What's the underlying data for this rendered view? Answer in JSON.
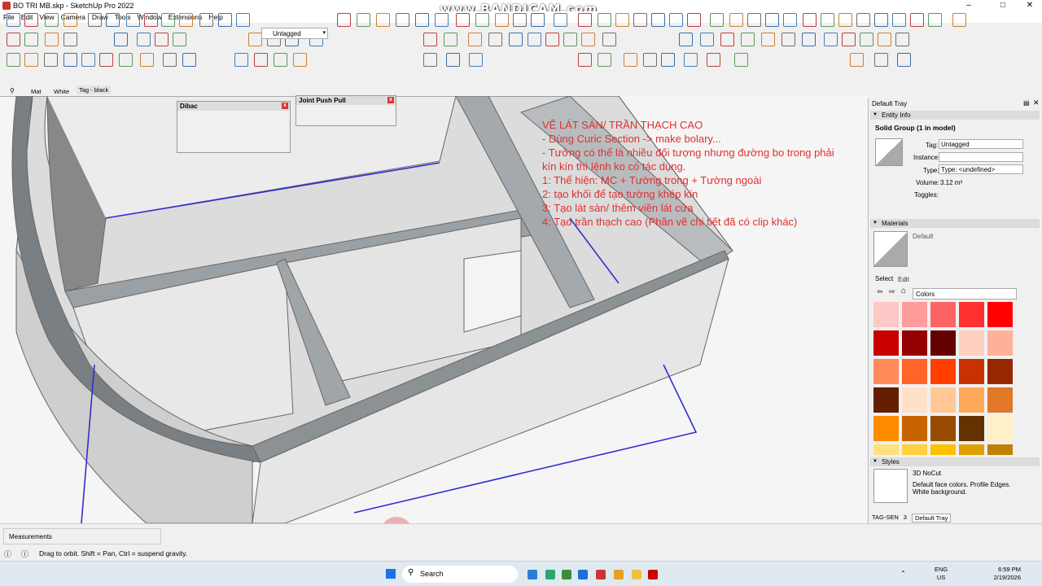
{
  "window": {
    "title": "BO TRI MB.skp - SketchUp Pro 2022",
    "watermark": "www.BANDICAM.com",
    "minimize": "–",
    "maximize": "□",
    "close": "✕"
  },
  "menu": [
    "File",
    "Edit",
    "View",
    "Camera",
    "Draw",
    "Tools",
    "Window",
    "Extensions",
    "Help"
  ],
  "toolbar": {
    "tag_select": "Untagged",
    "scene_tabs": [
      "Mat",
      "White",
      "Tag - black"
    ]
  },
  "dibac": {
    "title": "Dibac"
  },
  "joint": {
    "title": "Joint Push Pull"
  },
  "note": {
    "lines": [
      "VẼ LÁT SÀN/ TRẦN THẠCH CAO",
      "- Dùng Curic Section -> make bolary...",
      "- Tường có thể là nhiều đối tượng nhưng đường bo trong phải",
      "kín kín thì lệnh ko có tác dụng.",
      "1: Thể hiện: MC + Tường trong + Tường ngoài",
      "2: tạo khối để tạo tường khép kín",
      "3: Tạo lát sàn/ thêm viền lát cửa",
      "4: Tạo trần thạch cao (Phần vẽ chi tiết đã có clip khác)"
    ]
  },
  "tray": {
    "title": "Default Tray",
    "entity_info": {
      "header": "Entity Info",
      "selection": "Solid Group (1 in model)",
      "tag_label": "Tag:",
      "tag_value": "Untagged",
      "instance_label": "Instance:",
      "type_label": "Type:",
      "type_value": "Type: <undefined>",
      "volume_label": "Volume:",
      "volume_value": "3.12 m³",
      "toggles_label": "Toggles:"
    },
    "materials": {
      "header": "Materials",
      "current": "Default",
      "select_tab": "Select",
      "edit_tab": "Edit",
      "library": "Colors"
    },
    "styles": {
      "header": "Styles",
      "name": "3D NoCut",
      "description": "Default face colors. Profile Edges. White background."
    },
    "bottom_tabs": [
      "TAG-SEN",
      "3",
      "Default Tray"
    ]
  },
  "swatch_colors": [
    "#ffc8c8",
    "#ff9c9c",
    "#ff6464",
    "#ff3030",
    "#ff0000",
    "#c80000",
    "#960000",
    "#640000",
    "#ffd0c0",
    "#ffb09a",
    "#ff8c5a",
    "#ff6428",
    "#ff4000",
    "#c83200",
    "#962800",
    "#641e00",
    "#ffe0c8",
    "#ffc896",
    "#ffaa5a",
    "#e07828",
    "#ff8c00",
    "#c86400",
    "#964b00",
    "#643200",
    "#fff0c8",
    "#ffe080",
    "#ffd040",
    "#ffc000",
    "#e0a000",
    "#c08000"
  ],
  "status": {
    "measurements_label": "Measurements",
    "hint": "Drag to orbit. Shift = Pan, Ctrl = suspend gravity."
  },
  "taskbar": {
    "search": "Search",
    "lang1": "ENG",
    "lang2": "US",
    "time": "6:59 PM",
    "date": "2/19/2026"
  }
}
